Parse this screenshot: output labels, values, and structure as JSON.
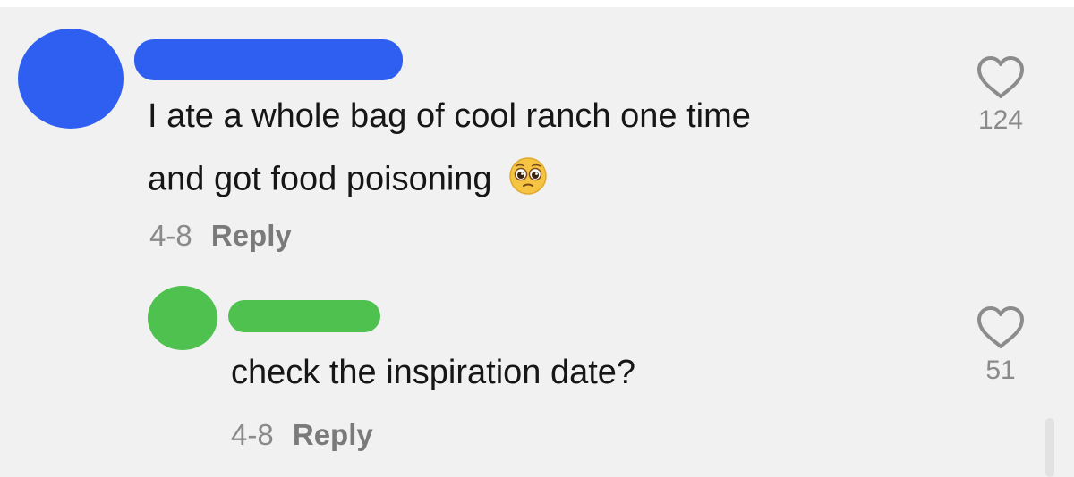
{
  "colors": {
    "background": "#f1f1f1",
    "avatar_1": "#2f5ff0",
    "avatar_2": "#4ec14e",
    "text": "#161616",
    "meta": "#8a8a8a"
  },
  "comments": [
    {
      "text_line_1": "I ate a whole bag of cool ranch one time",
      "text_line_2": "and got food poisoning",
      "emoji": "pleading-face-icon",
      "date": "4-8",
      "reply_label": "Reply",
      "likes": "124"
    },
    {
      "text": "check the inspiration date?",
      "date": "4-8",
      "reply_label": "Reply",
      "likes": "51"
    }
  ]
}
